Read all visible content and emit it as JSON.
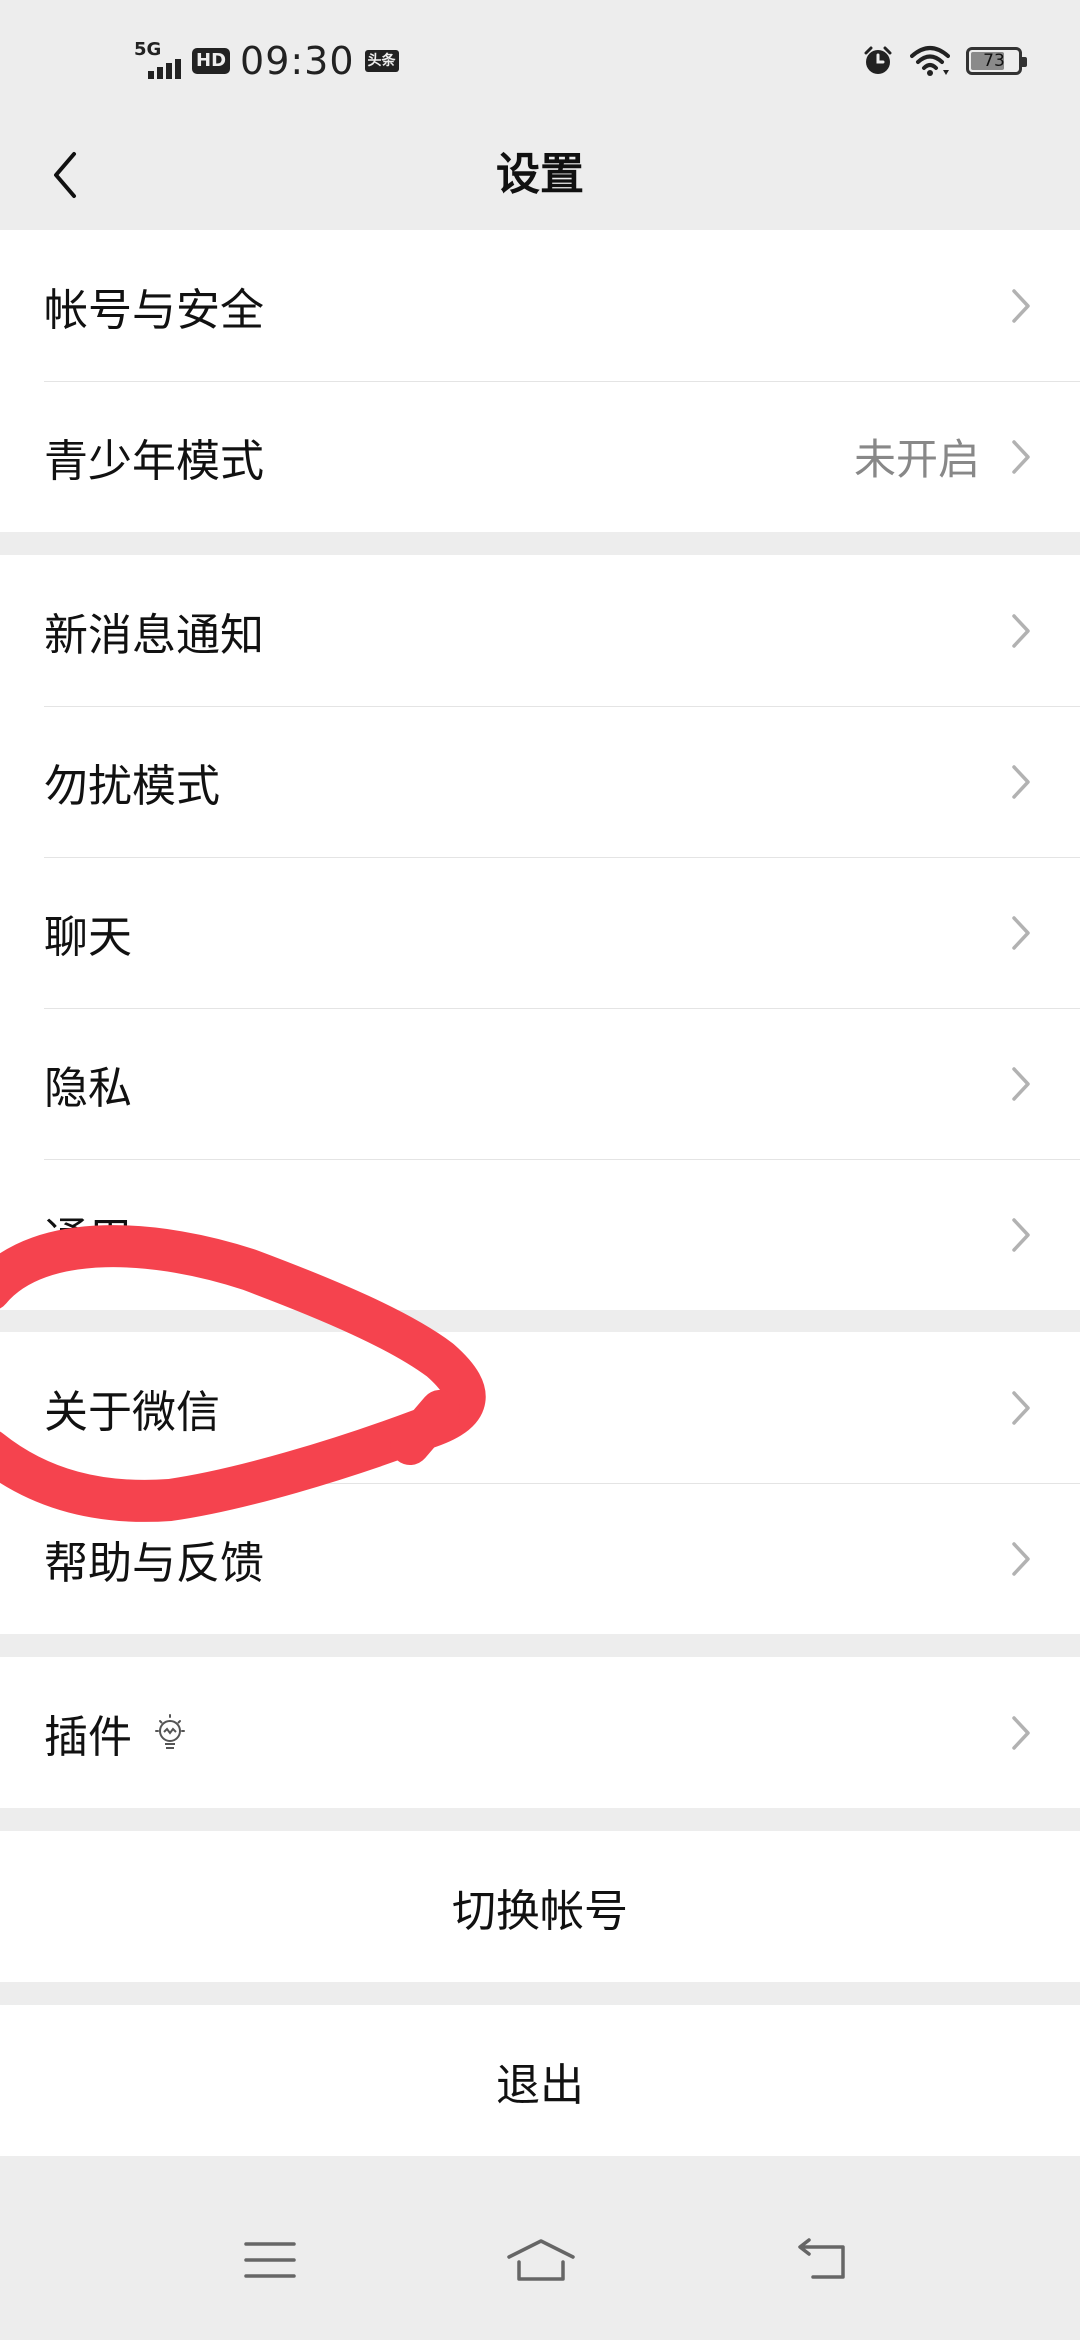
{
  "status_bar": {
    "network": "5G",
    "hd": "HD",
    "time": "09:30",
    "app_badge": "头条",
    "battery": "73",
    "battery_level": 0.73
  },
  "nav": {
    "title": "设置",
    "back_icon": "chevron-left-icon"
  },
  "groups": [
    {
      "items": [
        {
          "label": "帐号与安全"
        },
        {
          "label": "青少年模式",
          "value": "未开启"
        }
      ]
    },
    {
      "items": [
        {
          "label": "新消息通知"
        },
        {
          "label": "勿扰模式"
        },
        {
          "label": "聊天"
        },
        {
          "label": "隐私"
        },
        {
          "label": "通用"
        }
      ]
    },
    {
      "items": [
        {
          "label": "关于微信"
        },
        {
          "label": "帮助与反馈"
        }
      ]
    },
    {
      "items": [
        {
          "label": "插件",
          "icon": "lightbulb-icon"
        }
      ]
    }
  ],
  "actions": {
    "switch_account": "切换帐号",
    "logout": "退出"
  },
  "system_nav": {
    "menu_icon": "menu-icon",
    "home_icon": "home-icon",
    "back_icon": "back-arrow-icon"
  },
  "colors": {
    "background": "#ededed",
    "surface": "#ffffff",
    "annotation": "#f5434e"
  }
}
